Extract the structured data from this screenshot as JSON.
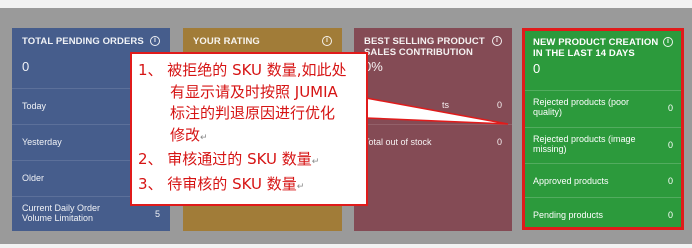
{
  "cards": {
    "pending_orders": {
      "title": "TOTAL PENDING ORDERS",
      "value": "0",
      "rows": [
        {
          "label": "Today",
          "value": ""
        },
        {
          "label": "Yesterday",
          "value": ""
        },
        {
          "label": "Older",
          "value": ""
        },
        {
          "label": "Current Daily Order Volume Limitation",
          "value": "5"
        }
      ]
    },
    "rating": {
      "title": "YOUR RATING"
    },
    "best_selling": {
      "title": "BEST SELLING PRODUCT SALES CONTRIBUTION",
      "value": "0%",
      "rows": [
        {
          "label": "ts",
          "value": "0"
        },
        {
          "label": "Total out of stock",
          "value": "0"
        }
      ]
    },
    "new_product": {
      "title": "NEW PRODUCT CREATION IN THE LAST 14 DAYS",
      "value": "0",
      "rows": [
        {
          "label": "Rejected products (poor quality)",
          "value": "0"
        },
        {
          "label": "Rejected products (image missing)",
          "value": "0"
        },
        {
          "label": "Approved products",
          "value": "0"
        },
        {
          "label": "Pending products",
          "value": "0"
        }
      ]
    }
  },
  "info_glyph": "i",
  "annotation": {
    "line1": "1、 被拒绝的 SKU 数量,如此处",
    "line2": "有显示请及时按照 JUMIA",
    "line3": "标注的判退原因进行优化",
    "line4": "修改",
    "line5": "2、 审核通过的 SKU 数量",
    "line6": "3、 待审核的 SKU 数量",
    "mark": "↵"
  },
  "colors": {
    "card_blue": "#465d8c",
    "card_gold": "#a17c38",
    "card_red": "#844b55",
    "card_green": "#2c9a3c",
    "highlight": "#e01b1b",
    "annotation_text": "#d61414"
  }
}
